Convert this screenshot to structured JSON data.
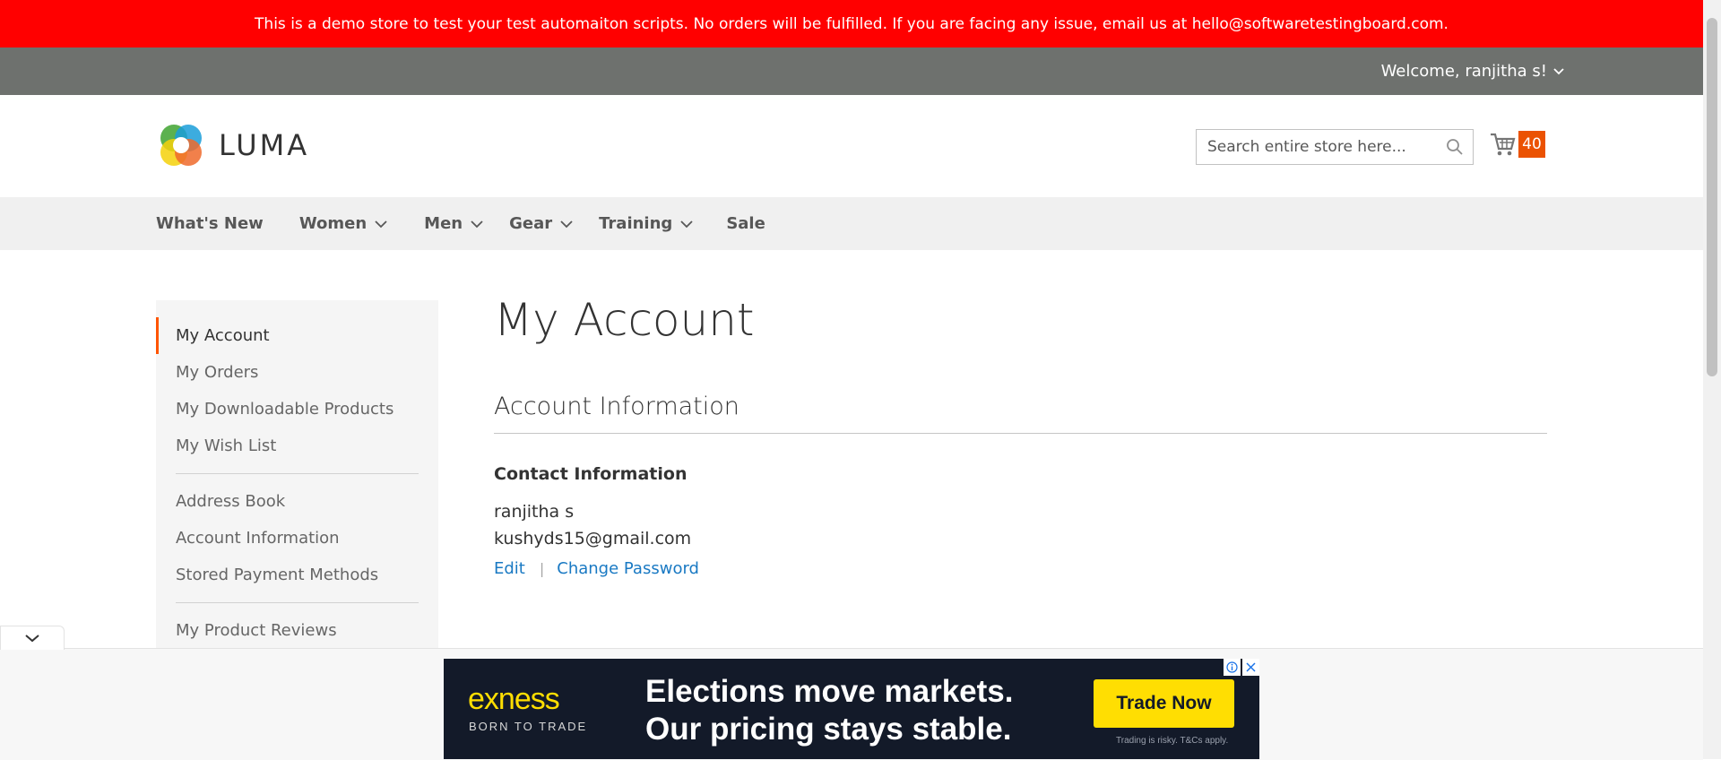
{
  "banner": {
    "text": "This is a demo store to test your test automaiton scripts. No orders will be fulfilled. If you are facing any issue, email us at hello@softwaretestingboard.com."
  },
  "topbar": {
    "welcome": "Welcome, ranjitha s!"
  },
  "header": {
    "logo_text": "LUMA",
    "search_placeholder": "Search entire store here...",
    "cart_count": "40"
  },
  "nav": {
    "items": [
      {
        "label": "What's New",
        "has_dropdown": false
      },
      {
        "label": "Women",
        "has_dropdown": true
      },
      {
        "label": "Men",
        "has_dropdown": true
      },
      {
        "label": "Gear",
        "has_dropdown": true
      },
      {
        "label": "Training",
        "has_dropdown": true
      },
      {
        "label": "Sale",
        "has_dropdown": false
      }
    ]
  },
  "sidebar": {
    "items": [
      {
        "label": "My Account",
        "active": true
      },
      {
        "label": "My Orders"
      },
      {
        "label": "My Downloadable Products"
      },
      {
        "label": "My Wish List"
      },
      {
        "label": "Address Book"
      },
      {
        "label": "Account Information"
      },
      {
        "label": "Stored Payment Methods"
      },
      {
        "label": "My Product Reviews"
      }
    ]
  },
  "main": {
    "page_title": "My Account",
    "section_title": "Account Information",
    "contact": {
      "title": "Contact Information",
      "name": "ranjitha s",
      "email": "kushyds15@gmail.com",
      "edit_label": "Edit",
      "change_password_label": "Change Password"
    }
  },
  "ad": {
    "logo": "exness",
    "tagline": "BORN TO TRADE",
    "headline_line1": "Elections move markets.",
    "headline_line2": "Our pricing stays stable.",
    "cta": "Trade Now",
    "disclaimer": "Trading is risky. T&Cs apply."
  },
  "colors": {
    "banner_bg": "#ff0000",
    "topbar_bg": "#6e716e",
    "accent": "#ff5501",
    "link": "#1979c3",
    "cart_badge": "#eb5202",
    "ad_bg": "#131a29",
    "ad_yellow": "#ffde02"
  }
}
